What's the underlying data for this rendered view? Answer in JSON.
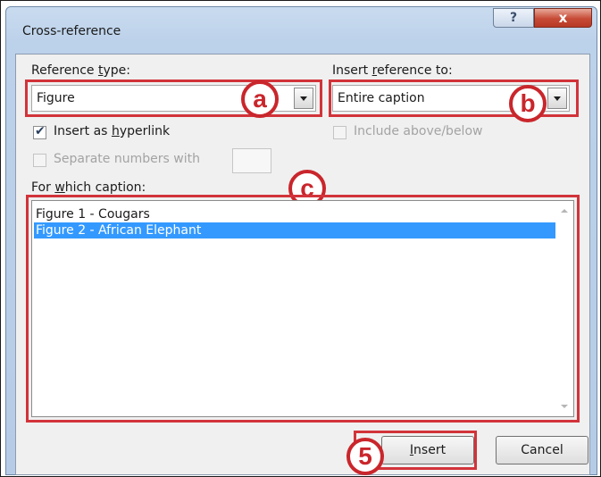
{
  "dialog": {
    "title": "Cross-reference",
    "help_glyph": "?",
    "close_glyph": "x"
  },
  "reference_type": {
    "label_pre": "Reference ",
    "label_u": "t",
    "label_post": "ype:",
    "value": "Figure"
  },
  "insert_reference_to": {
    "label_pre": "Insert ",
    "label_u": "r",
    "label_post": "eference to:",
    "value": "Entire caption"
  },
  "options": {
    "insert_hyperlink_pre": "Insert as ",
    "insert_hyperlink_u": "h",
    "insert_hyperlink_post": "yperlink",
    "insert_hyperlink_checked": true,
    "include_above_below": "Include above/below",
    "separate_numbers": "Separate numbers with"
  },
  "caption_list": {
    "label_pre": "For ",
    "label_u": "w",
    "label_post": "hich caption:",
    "items": [
      "Figure 1 - Cougars",
      "Figure 2 - African Elephant"
    ],
    "selected_index": 1
  },
  "buttons": {
    "insert_u": "I",
    "insert_rest": "nsert",
    "cancel": "Cancel"
  },
  "annotations": {
    "a": "a",
    "b": "b",
    "c": "c",
    "step": "5",
    "highlight_color": "#d2333a"
  }
}
